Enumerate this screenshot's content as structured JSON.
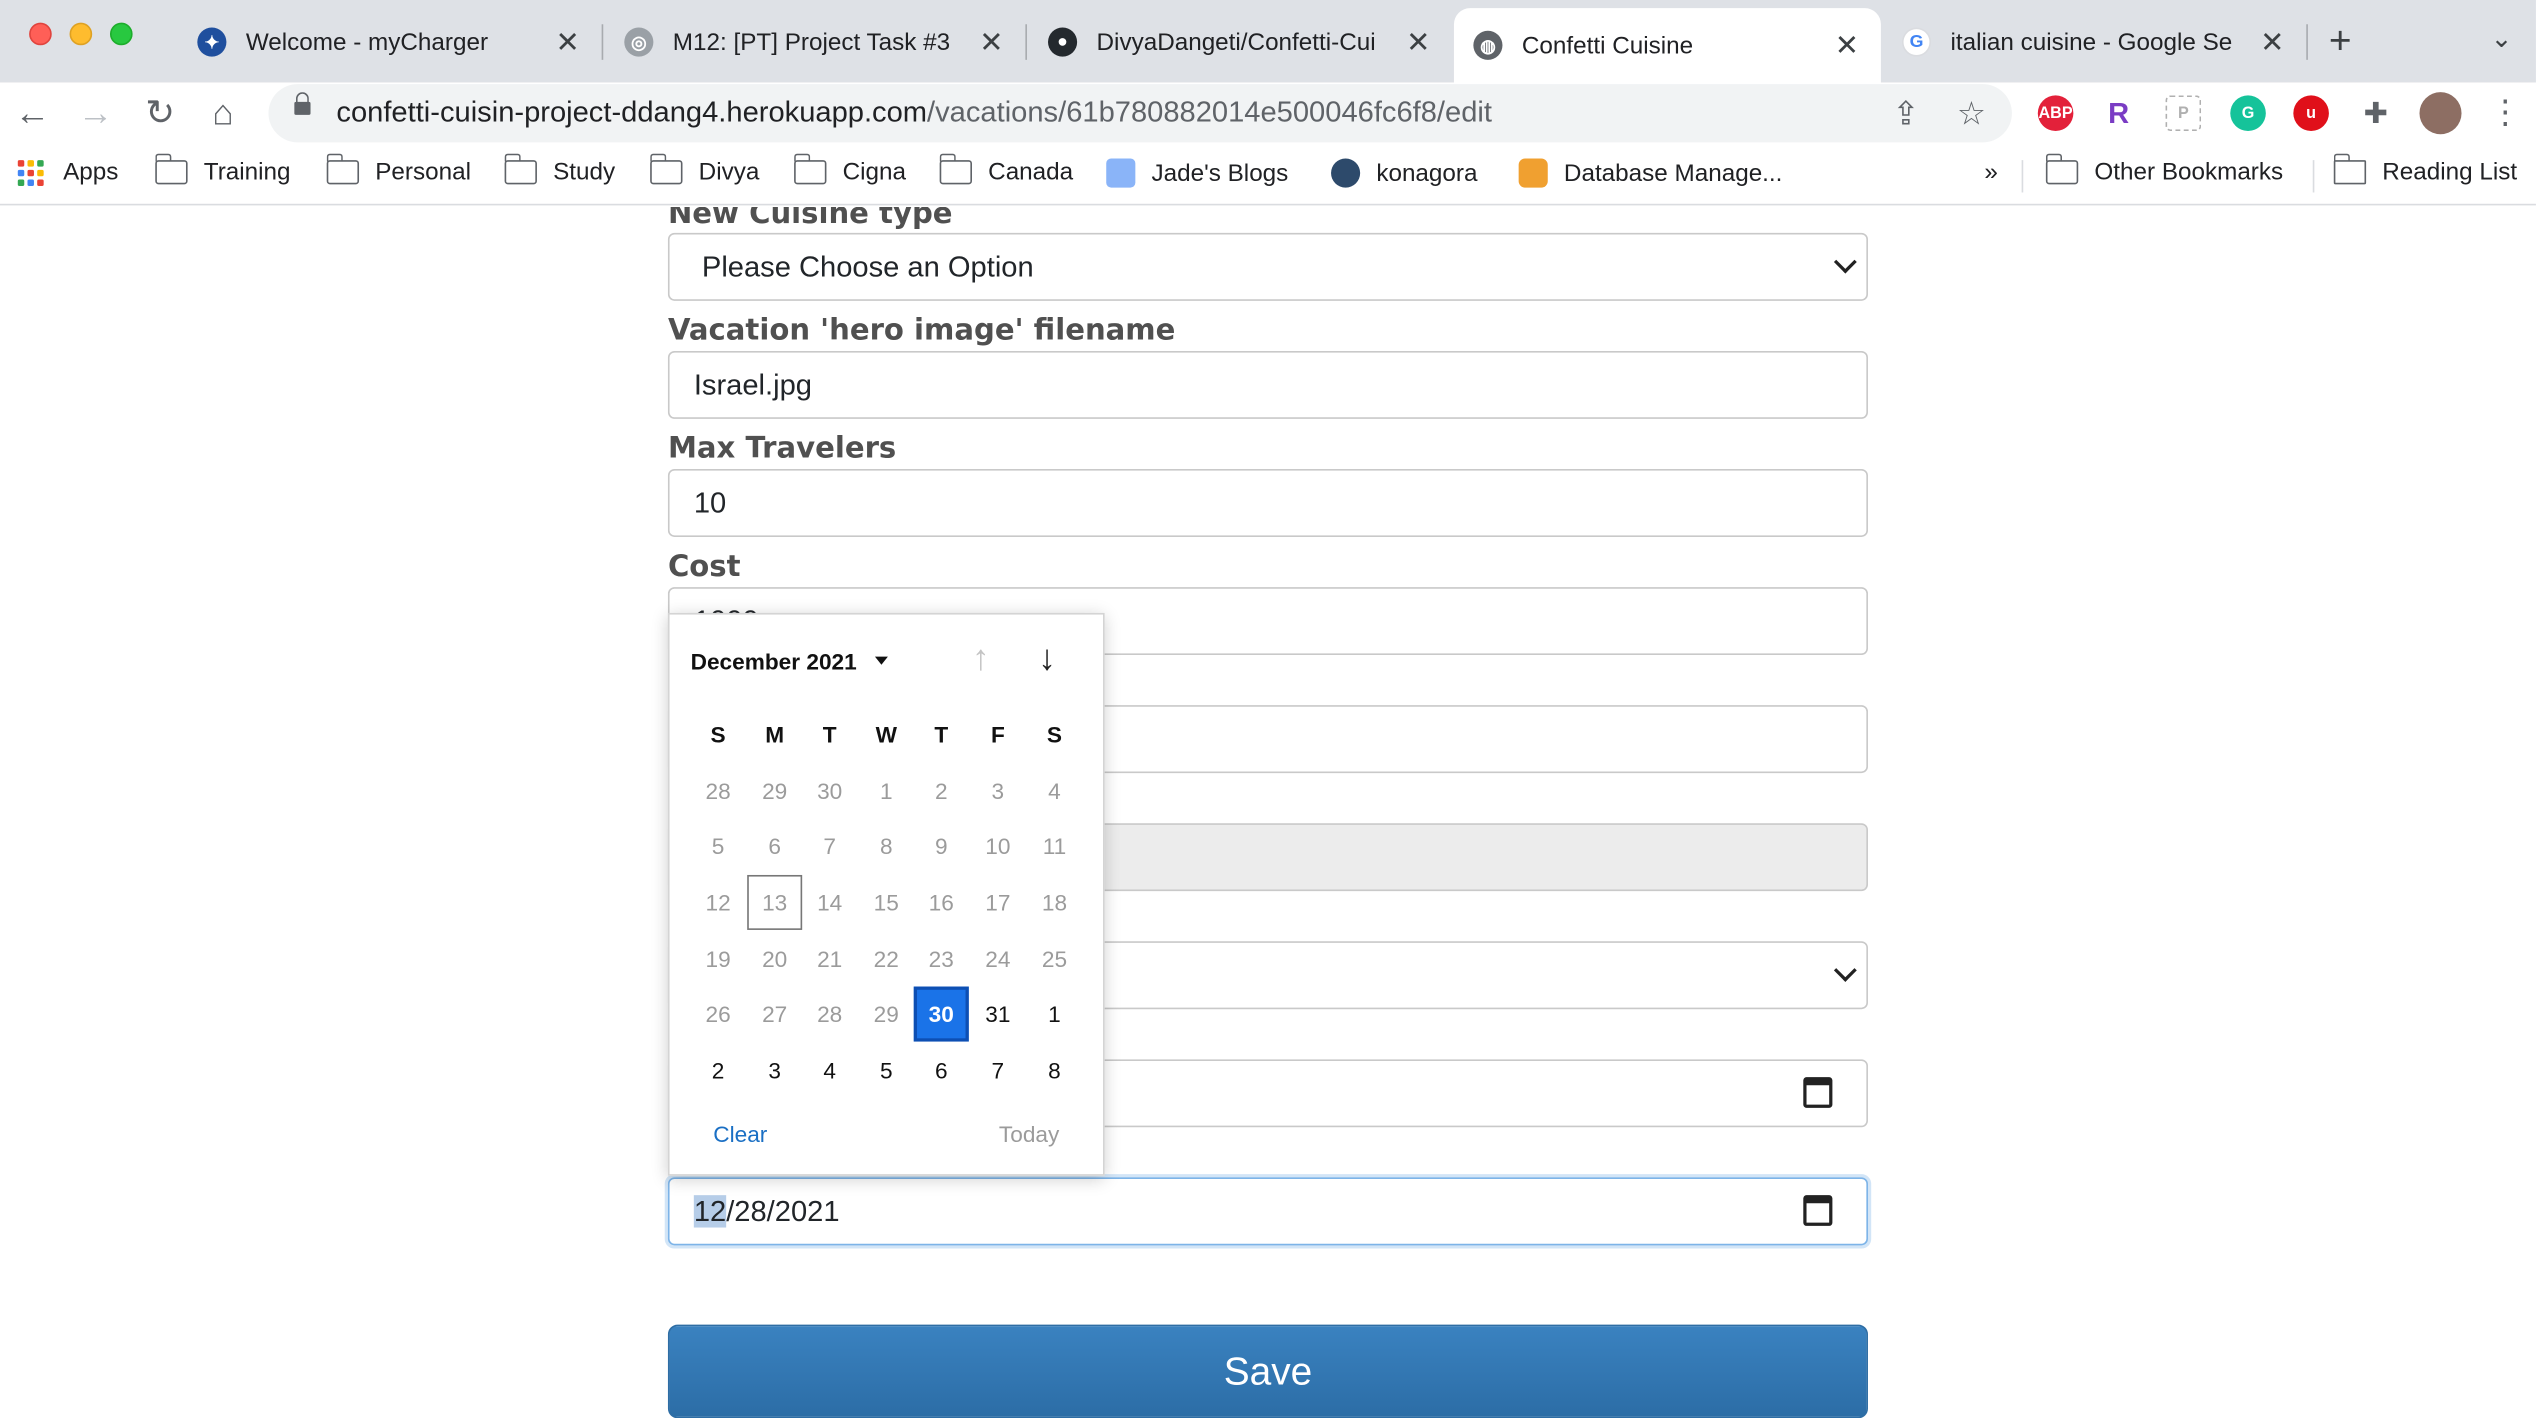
{
  "browser": {
    "tabs": [
      {
        "title": "Welcome - myCharger",
        "icon": "charger-logo-icon",
        "color": "#1f4f9e"
      },
      {
        "title": "M12: [PT] Project Task #3",
        "icon": "canvas-logo-icon",
        "color": "#9aa0a6"
      },
      {
        "title": "DivyaDangeti/Confetti-Cui",
        "icon": "github-icon",
        "color": "#24292e"
      },
      {
        "title": "Confetti Cuisine",
        "icon": "globe-icon",
        "color": "#5f6368"
      },
      {
        "title": "italian cuisine - Google Se",
        "icon": "google-icon",
        "color": "#4285f4"
      }
    ],
    "active_tab": 3,
    "url_domain": "confetti-cuisin-project-ddang4.herokuapp.com",
    "url_path": "/vacations/61b780882014e500046fc6f8/edit",
    "bookmarks": [
      "Apps",
      "Training",
      "Personal",
      "Study",
      "Divya",
      "Cigna",
      "Canada",
      "Jade's Blogs",
      "konagora",
      "Database Manage..."
    ],
    "bookmarks_more": "»",
    "other_bookmarks": "Other Bookmarks",
    "reading_list": "Reading List",
    "extensions": [
      {
        "name": "adblock-plus-icon",
        "label": "ABP",
        "color": "#e3213a"
      },
      {
        "name": "r-extension-icon",
        "label": "R",
        "color": "#7a3cc4"
      },
      {
        "name": "p-extension-icon",
        "label": "P",
        "color": "#b0b0b0"
      },
      {
        "name": "grammarly-icon",
        "label": "G",
        "color": "#15c39a"
      },
      {
        "name": "ublock-icon",
        "label": "u",
        "color": "#e0101a"
      }
    ]
  },
  "form": {
    "cuisine_label": "New Cuisine type",
    "cuisine_value": "Please Choose an Option",
    "hero_label": "Vacation 'hero image' filename",
    "hero_value": "Israel.jpg",
    "max_label": "Max Travelers",
    "max_value": "10",
    "cost_label": "Cost",
    "cost_value": "1000",
    "end_date_month": "12",
    "end_date_rest": "/28/2021",
    "save_label": "Save"
  },
  "datepicker": {
    "month_label": "December 2021",
    "weekdays": [
      "S",
      "M",
      "T",
      "W",
      "T",
      "F",
      "S"
    ],
    "weeks": [
      [
        "28",
        "29",
        "30",
        "1",
        "2",
        "3",
        "4"
      ],
      [
        "5",
        "6",
        "7",
        "8",
        "9",
        "10",
        "11"
      ],
      [
        "12",
        "13",
        "14",
        "15",
        "16",
        "17",
        "18"
      ],
      [
        "19",
        "20",
        "21",
        "22",
        "23",
        "24",
        "25"
      ],
      [
        "26",
        "27",
        "28",
        "29",
        "30",
        "31",
        "1"
      ],
      [
        "2",
        "3",
        "4",
        "5",
        "6",
        "7",
        "8"
      ]
    ],
    "today_day": "13",
    "selected_day": "30",
    "enabled_days": [
      "30",
      "31",
      "1",
      "2",
      "3",
      "4",
      "5",
      "6",
      "7",
      "8"
    ],
    "clear_label": "Clear",
    "today_label": "Today"
  }
}
